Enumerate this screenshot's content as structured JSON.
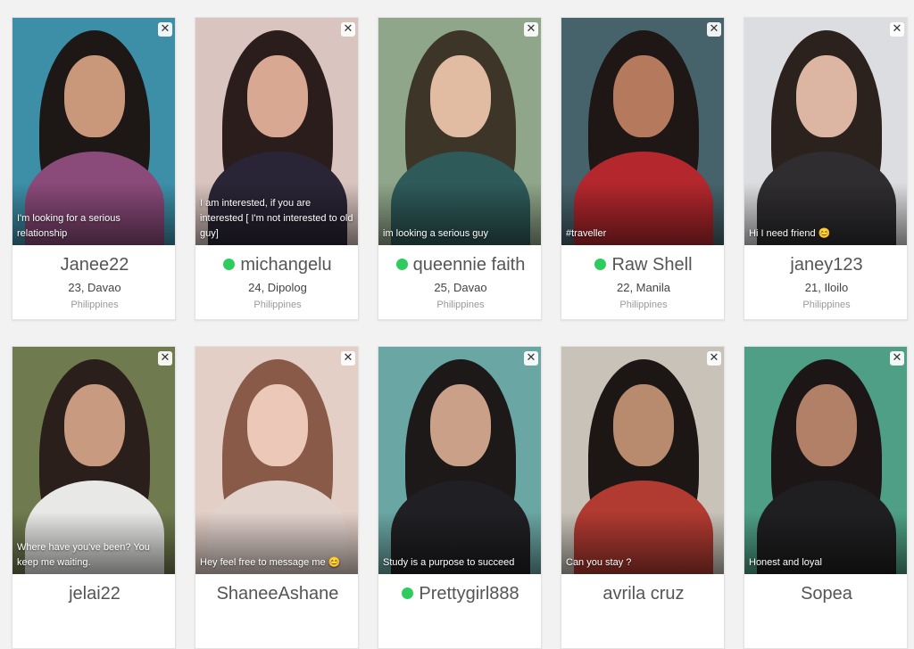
{
  "close_symbol": "✕",
  "cards": [
    {
      "name": "Janee22",
      "online": false,
      "age_city": "23, Davao",
      "country": "Philippines",
      "caption": "I'm looking for a serious relationship",
      "bg": "#3d8fa8",
      "hair": "#1d1815",
      "skin": "#c9977a",
      "top": "#8a4a7a"
    },
    {
      "name": "michangelu",
      "online": true,
      "age_city": "24, Dipolog",
      "country": "Philippines",
      "caption": "I am interested, if you are interested [ I'm not interested to old guy]",
      "bg": "#d9c4bf",
      "hair": "#2a1d1c",
      "skin": "#d8a892",
      "top": "#2a2536"
    },
    {
      "name": "queennie faith",
      "online": true,
      "age_city": "25, Davao",
      "country": "Philippines",
      "caption": "im looking a serious guy",
      "bg": "#8fa68a",
      "hair": "#3d3527",
      "skin": "#e2bba3",
      "top": "#2f5a5a"
    },
    {
      "name": "Raw Shell",
      "online": true,
      "age_city": "22, Manila",
      "country": "Philippines",
      "caption": "#traveller",
      "bg": "#46636b",
      "hair": "#1e1715",
      "skin": "#b57a5e",
      "top": "#b3272d"
    },
    {
      "name": "janey123",
      "online": false,
      "age_city": "21, Iloilo",
      "country": "Philippines",
      "caption": "Hi I need friend 😊",
      "bg": "#dcdde0",
      "hair": "#2b211d",
      "skin": "#dcb6a3",
      "top": "#2f2d30"
    },
    {
      "name": "jelai22",
      "online": false,
      "age_city": "",
      "country": "",
      "caption": "Where have you've been? You keep me waiting.",
      "bg": "#6f7a4e",
      "hair": "#2a1f1a",
      "skin": "#c89a7f",
      "top": "#e8e8e6"
    },
    {
      "name": "ShaneeAshane",
      "online": false,
      "age_city": "",
      "country": "",
      "caption": "Hey feel free to message me 😊",
      "bg": "#e3cfc6",
      "hair": "#8a5a48",
      "skin": "#ecc8b8",
      "top": "#e2d2cc"
    },
    {
      "name": "Prettygirl888",
      "online": true,
      "age_city": "",
      "country": "",
      "caption": "Study is a purpose to succeed",
      "bg": "#6aa6a4",
      "hair": "#1d1918",
      "skin": "#caa088",
      "top": "#202024"
    },
    {
      "name": "avrila cruz",
      "online": false,
      "age_city": "",
      "country": "",
      "caption": "Can you stay ?",
      "bg": "#c8c2b8",
      "hair": "#1c1714",
      "skin": "#b88a6e",
      "top": "#b13a31"
    },
    {
      "name": "Sopea",
      "online": false,
      "age_city": "",
      "country": "",
      "caption": "Honest and loyal",
      "bg": "#4e9f86",
      "hair": "#1c1716",
      "skin": "#b28066",
      "top": "#1f1f21"
    }
  ]
}
